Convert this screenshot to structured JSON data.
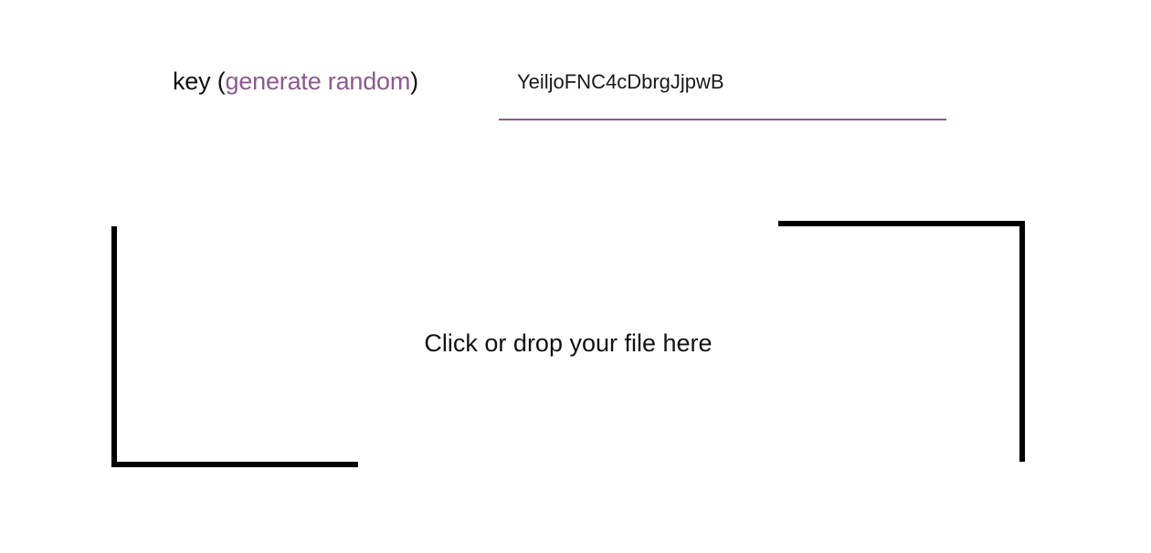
{
  "key": {
    "label": "key",
    "open_paren": " (",
    "generate_link": "generate random",
    "close_paren": ")",
    "value": "YeiljoFNC4cDbrgJjpwB"
  },
  "dropzone": {
    "label": "Click or drop your file here"
  },
  "colors": {
    "accent": "#8b5b8e",
    "text": "#111111",
    "frame": "#000000"
  }
}
